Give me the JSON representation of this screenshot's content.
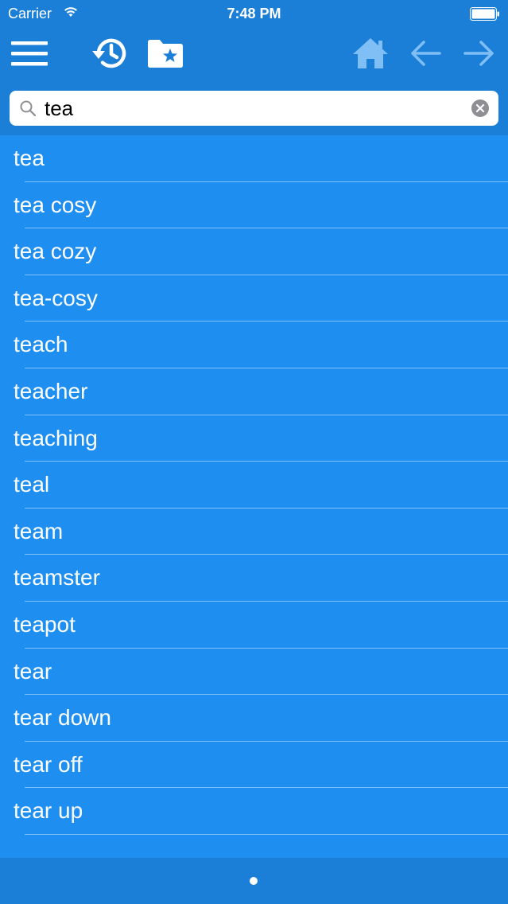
{
  "status_bar": {
    "carrier": "Carrier",
    "time": "7:48 PM",
    "wifi_icon": "wifi-icon",
    "battery_icon": "battery-icon"
  },
  "toolbar": {
    "icons": [
      "menu-icon",
      "history-icon",
      "favorites-folder-icon",
      "home-icon",
      "back-arrow-icon",
      "forward-arrow-icon"
    ]
  },
  "search": {
    "value": "tea",
    "icon": "search-icon",
    "clear_icon": "clear-icon"
  },
  "words": [
    "tea",
    "tea cosy",
    "tea cozy",
    "tea-cosy",
    "teach",
    "teacher",
    "teaching",
    "teal",
    "team",
    "teamster",
    "teapot",
    "tear",
    "tear down",
    "tear off",
    "tear up"
  ],
  "colors": {
    "background": "#1e8ff0",
    "bar": "#1b7fd8",
    "text": "#ffffff",
    "disabled_icon": "#7fbff5"
  }
}
